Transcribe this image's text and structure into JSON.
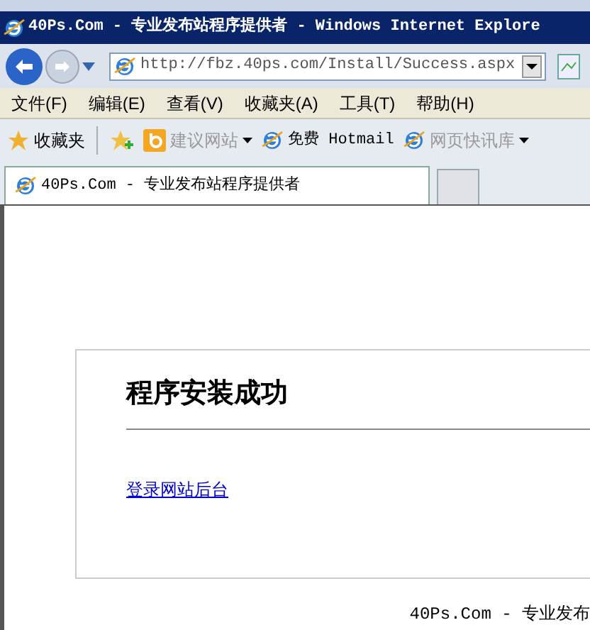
{
  "window": {
    "title": "40Ps.Com - 专业发布站程序提供者 - Windows Internet Explore"
  },
  "address_bar": {
    "value": "http://fbz.40ps.com/Install/Success.aspx"
  },
  "menu": [
    "文件(F)",
    "编辑(E)",
    "查看(V)",
    "收藏夹(A)",
    "工具(T)",
    "帮助(H)"
  ],
  "favorites_bar": {
    "label": "收藏夹",
    "items": [
      {
        "label": "建议网站",
        "kind": "dropdown",
        "disabled": true
      },
      {
        "label": "免费 Hotmail",
        "kind": "link",
        "disabled": false
      },
      {
        "label": "网页快讯库",
        "kind": "dropdown",
        "disabled": true
      }
    ]
  },
  "tabs": [
    {
      "label": "40Ps.Com - 专业发布站程序提供者",
      "selected": true
    }
  ],
  "page": {
    "heading": "程序安装成功",
    "link": "登录网站后台",
    "footer": "40Ps.Com - 专业发布"
  }
}
